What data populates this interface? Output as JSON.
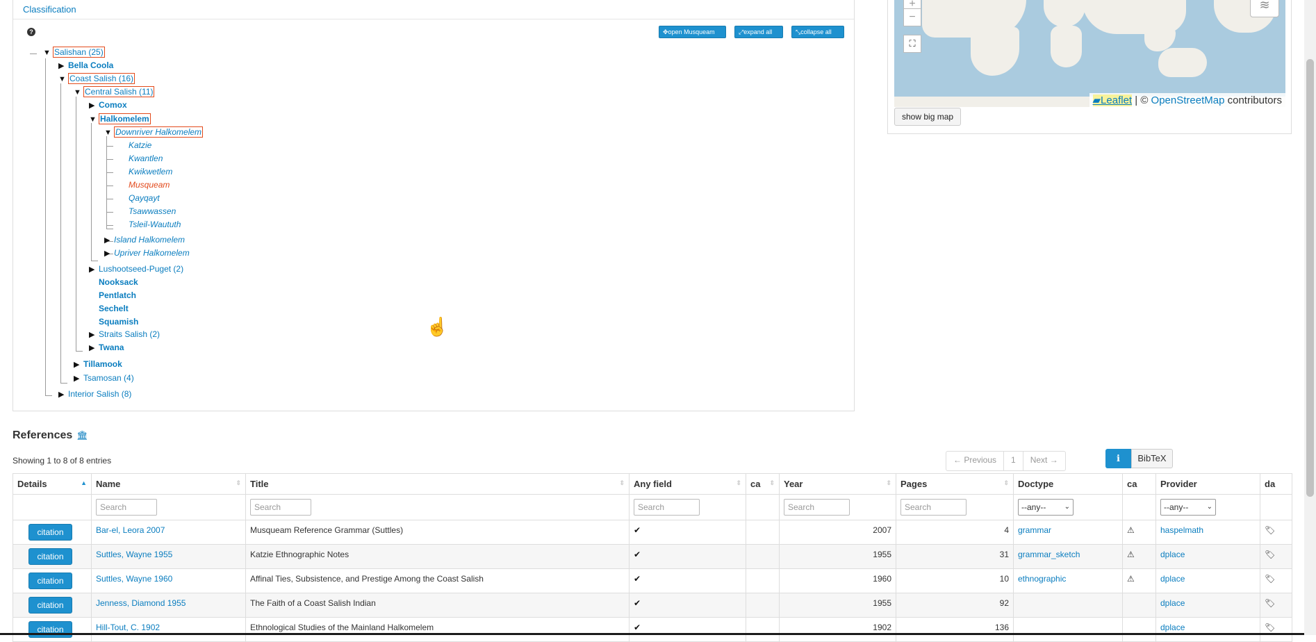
{
  "classification": {
    "heading": "Classification",
    "help": "?",
    "buttons": {
      "open": "open Musqueam",
      "expand": "expand all",
      "collapse": "collapse all"
    },
    "tree": [
      "Salishan (25)",
      "Bella Coola",
      "Coast Salish (16)",
      "Central Salish (11)",
      "Comox",
      "Halkomelem",
      "Downriver Halkomelem",
      "Katzie",
      "Kwantlen",
      "Kwikwetlem",
      "Musqueam",
      "Qayqayt",
      "Tsawwassen",
      "Tsleil-Waututh",
      "Island Halkomelem",
      "Upriver Halkomelem",
      "Lushootseed-Puget (2)",
      "Nooksack",
      "Pentlatch",
      "Sechelt",
      "Squamish",
      "Straits Salish (2)",
      "Twana",
      "Tillamook",
      "Tsamosan (4)",
      "Interior Salish (8)"
    ]
  },
  "map": {
    "zoom_in": "+",
    "zoom_out": "−",
    "attribution": {
      "leaflet": "Leaflet",
      "sep": " | © ",
      "osm": "OpenStreetMap",
      "tail": " contributors"
    },
    "show_big_map": "show big map"
  },
  "references": {
    "title": "References",
    "showing": "Showing 1 to 8 of 8 entries",
    "pager": {
      "prev": "← Previous",
      "page": "1",
      "next": "Next →"
    },
    "bibtex": "BibTeX",
    "columns": [
      "Details",
      "Name",
      "Title",
      "Any field",
      "ca",
      "Year",
      "Pages",
      "Doctype",
      "ca",
      "Provider",
      "da"
    ],
    "search_placeholder": "Search",
    "any_option": "--any--",
    "citation_label": "citation",
    "rows": [
      {
        "name": "Bar-el, Leora 2007",
        "title": "Musqueam Reference Grammar (Suttles)",
        "year": "2007",
        "pages": "4",
        "doctype": "grammar",
        "warn": true,
        "provider": "haspelmath"
      },
      {
        "name": "Suttles, Wayne 1955",
        "title": "Katzie Ethnographic Notes",
        "year": "1955",
        "pages": "31",
        "doctype": "grammar_sketch",
        "warn": true,
        "provider": "dplace"
      },
      {
        "name": "Suttles, Wayne 1960",
        "title": "Affinal Ties, Subsistence, and Prestige Among the Coast Salish",
        "year": "1960",
        "pages": "10",
        "doctype": "ethnographic",
        "warn": true,
        "provider": "dplace"
      },
      {
        "name": "Jenness, Diamond 1955",
        "title": "The Faith of a Coast Salish Indian",
        "year": "1955",
        "pages": "92",
        "doctype": "",
        "warn": false,
        "provider": "dplace"
      },
      {
        "name": "Hill-Tout, C. 1902",
        "title": "Ethnological Studies of the Mainland Halkomelem",
        "year": "1902",
        "pages": "136",
        "doctype": "",
        "warn": false,
        "provider": "dplace"
      }
    ]
  }
}
